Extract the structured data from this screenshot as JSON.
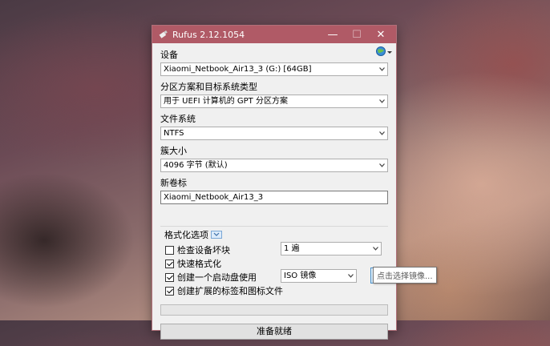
{
  "window": {
    "title": "Rufus 2.12.1054",
    "controls": {
      "minimize": "—",
      "maximize": "☐",
      "close": "✕"
    }
  },
  "sections": {
    "device_label": "设备",
    "device_value": "Xiaomi_Netbook_Air13_3 (G:) [64GB]",
    "partition_label": "分区方案和目标系统类型",
    "partition_value": "用于 UEFI 计算机的 GPT 分区方案",
    "filesystem_label": "文件系统",
    "filesystem_value": "NTFS",
    "cluster_label": "簇大小",
    "cluster_value": "4096 字节 (默认)",
    "volume_label": "新卷标",
    "volume_value": "Xiaomi_Netbook_Air13_3"
  },
  "format_options": {
    "title": "格式化选项",
    "check_bad_blocks": {
      "label": "检查设备坏块",
      "checked": false,
      "passes": "1 遍"
    },
    "quick_format": {
      "label": "快速格式化",
      "checked": true
    },
    "bootable": {
      "label": "创建一个启动盘使用",
      "checked": true,
      "type": "ISO 镜像"
    },
    "extended_label": {
      "label": "创建扩展的标签和图标文件",
      "checked": true
    }
  },
  "tooltip": "点击选择镜像...",
  "status": "准备就绪",
  "icons": {
    "app": "usb-drive-icon",
    "language": "globe-icon",
    "dropdown": "chevron-down-icon",
    "disk": "optical-disc-icon"
  },
  "colors": {
    "titlebar": "#b05a66",
    "accent": "#4a90c8"
  }
}
